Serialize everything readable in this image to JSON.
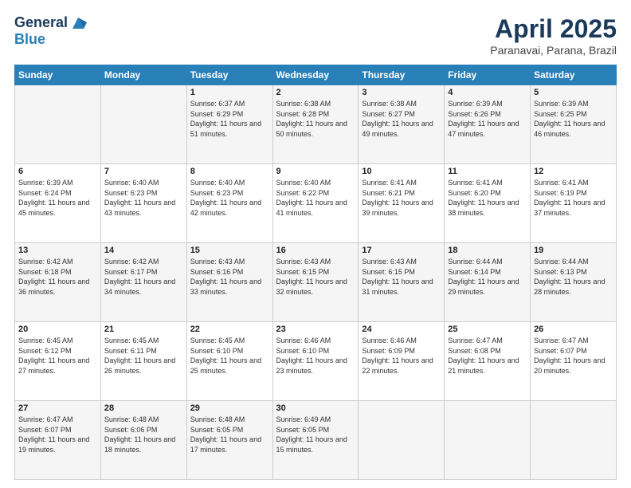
{
  "header": {
    "logo_general": "General",
    "logo_blue": "Blue",
    "month_title": "April 2025",
    "subtitle": "Paranavai, Parana, Brazil"
  },
  "days_of_week": [
    "Sunday",
    "Monday",
    "Tuesday",
    "Wednesday",
    "Thursday",
    "Friday",
    "Saturday"
  ],
  "weeks": [
    [
      {
        "day": "",
        "info": ""
      },
      {
        "day": "",
        "info": ""
      },
      {
        "day": "1",
        "info": "Sunrise: 6:37 AM\nSunset: 6:29 PM\nDaylight: 11 hours and 51 minutes."
      },
      {
        "day": "2",
        "info": "Sunrise: 6:38 AM\nSunset: 6:28 PM\nDaylight: 11 hours and 50 minutes."
      },
      {
        "day": "3",
        "info": "Sunrise: 6:38 AM\nSunset: 6:27 PM\nDaylight: 11 hours and 49 minutes."
      },
      {
        "day": "4",
        "info": "Sunrise: 6:39 AM\nSunset: 6:26 PM\nDaylight: 11 hours and 47 minutes."
      },
      {
        "day": "5",
        "info": "Sunrise: 6:39 AM\nSunset: 6:25 PM\nDaylight: 11 hours and 46 minutes."
      }
    ],
    [
      {
        "day": "6",
        "info": "Sunrise: 6:39 AM\nSunset: 6:24 PM\nDaylight: 11 hours and 45 minutes."
      },
      {
        "day": "7",
        "info": "Sunrise: 6:40 AM\nSunset: 6:23 PM\nDaylight: 11 hours and 43 minutes."
      },
      {
        "day": "8",
        "info": "Sunrise: 6:40 AM\nSunset: 6:23 PM\nDaylight: 11 hours and 42 minutes."
      },
      {
        "day": "9",
        "info": "Sunrise: 6:40 AM\nSunset: 6:22 PM\nDaylight: 11 hours and 41 minutes."
      },
      {
        "day": "10",
        "info": "Sunrise: 6:41 AM\nSunset: 6:21 PM\nDaylight: 11 hours and 39 minutes."
      },
      {
        "day": "11",
        "info": "Sunrise: 6:41 AM\nSunset: 6:20 PM\nDaylight: 11 hours and 38 minutes."
      },
      {
        "day": "12",
        "info": "Sunrise: 6:41 AM\nSunset: 6:19 PM\nDaylight: 11 hours and 37 minutes."
      }
    ],
    [
      {
        "day": "13",
        "info": "Sunrise: 6:42 AM\nSunset: 6:18 PM\nDaylight: 11 hours and 36 minutes."
      },
      {
        "day": "14",
        "info": "Sunrise: 6:42 AM\nSunset: 6:17 PM\nDaylight: 11 hours and 34 minutes."
      },
      {
        "day": "15",
        "info": "Sunrise: 6:43 AM\nSunset: 6:16 PM\nDaylight: 11 hours and 33 minutes."
      },
      {
        "day": "16",
        "info": "Sunrise: 6:43 AM\nSunset: 6:15 PM\nDaylight: 11 hours and 32 minutes."
      },
      {
        "day": "17",
        "info": "Sunrise: 6:43 AM\nSunset: 6:15 PM\nDaylight: 11 hours and 31 minutes."
      },
      {
        "day": "18",
        "info": "Sunrise: 6:44 AM\nSunset: 6:14 PM\nDaylight: 11 hours and 29 minutes."
      },
      {
        "day": "19",
        "info": "Sunrise: 6:44 AM\nSunset: 6:13 PM\nDaylight: 11 hours and 28 minutes."
      }
    ],
    [
      {
        "day": "20",
        "info": "Sunrise: 6:45 AM\nSunset: 6:12 PM\nDaylight: 11 hours and 27 minutes."
      },
      {
        "day": "21",
        "info": "Sunrise: 6:45 AM\nSunset: 6:11 PM\nDaylight: 11 hours and 26 minutes."
      },
      {
        "day": "22",
        "info": "Sunrise: 6:45 AM\nSunset: 6:10 PM\nDaylight: 11 hours and 25 minutes."
      },
      {
        "day": "23",
        "info": "Sunrise: 6:46 AM\nSunset: 6:10 PM\nDaylight: 11 hours and 23 minutes."
      },
      {
        "day": "24",
        "info": "Sunrise: 6:46 AM\nSunset: 6:09 PM\nDaylight: 11 hours and 22 minutes."
      },
      {
        "day": "25",
        "info": "Sunrise: 6:47 AM\nSunset: 6:08 PM\nDaylight: 11 hours and 21 minutes."
      },
      {
        "day": "26",
        "info": "Sunrise: 6:47 AM\nSunset: 6:07 PM\nDaylight: 11 hours and 20 minutes."
      }
    ],
    [
      {
        "day": "27",
        "info": "Sunrise: 6:47 AM\nSunset: 6:07 PM\nDaylight: 11 hours and 19 minutes."
      },
      {
        "day": "28",
        "info": "Sunrise: 6:48 AM\nSunset: 6:06 PM\nDaylight: 11 hours and 18 minutes."
      },
      {
        "day": "29",
        "info": "Sunrise: 6:48 AM\nSunset: 6:05 PM\nDaylight: 11 hours and 17 minutes."
      },
      {
        "day": "30",
        "info": "Sunrise: 6:49 AM\nSunset: 6:05 PM\nDaylight: 11 hours and 15 minutes."
      },
      {
        "day": "",
        "info": ""
      },
      {
        "day": "",
        "info": ""
      },
      {
        "day": "",
        "info": ""
      }
    ]
  ]
}
